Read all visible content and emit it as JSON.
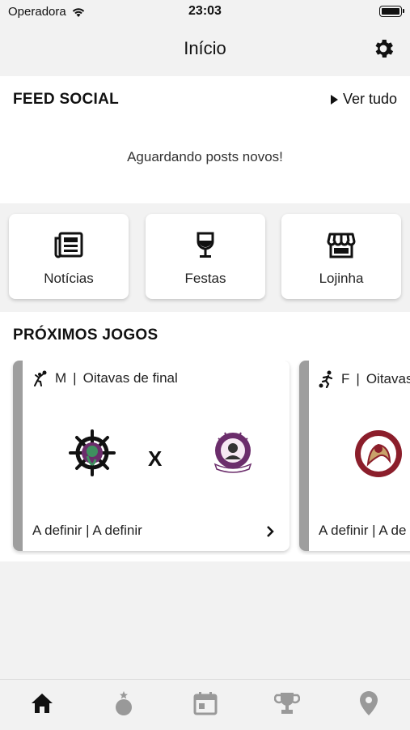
{
  "status_bar": {
    "carrier": "Operadora",
    "time": "23:03"
  },
  "header": {
    "title": "Início"
  },
  "feed": {
    "title": "FEED SOCIAL",
    "see_all": "Ver tudo",
    "empty_message": "Aguardando posts novos!"
  },
  "shortcuts": [
    {
      "label": "Notícias",
      "icon": "newspaper-icon"
    },
    {
      "label": "Festas",
      "icon": "wine-glass-icon"
    },
    {
      "label": "Lojinha",
      "icon": "storefront-icon"
    }
  ],
  "games": {
    "title": "PRÓXIMOS JOGOS",
    "cards": [
      {
        "gender": "M",
        "separator": "|",
        "stage": "Oitavas de final",
        "sport_icon": "volleyball-player-icon",
        "vs": "X",
        "date": "A definir",
        "time": "A definir"
      },
      {
        "gender": "F",
        "separator": "|",
        "stage": "Oitavas",
        "sport_icon": "soccer-player-icon",
        "date": "A definir",
        "time": "A de"
      }
    ]
  },
  "tabs": [
    {
      "name": "home",
      "active": true
    },
    {
      "name": "medal",
      "active": false
    },
    {
      "name": "calendar",
      "active": false
    },
    {
      "name": "trophy",
      "active": false
    },
    {
      "name": "location",
      "active": false
    }
  ],
  "colors": {
    "active_tab": "#111111",
    "inactive_tab": "#999999",
    "card_stripe": "#9e9e9e",
    "logo_purple": "#6b2d6b",
    "logo_maroon": "#8b1e2b"
  }
}
